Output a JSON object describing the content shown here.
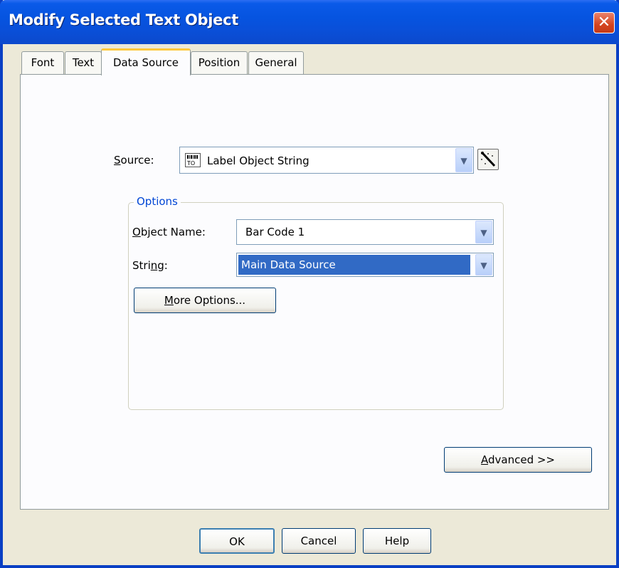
{
  "window": {
    "title": "Modify Selected Text Object",
    "close_glyph": "✕"
  },
  "tabs": [
    {
      "label": "Font",
      "active": false
    },
    {
      "label": "Text",
      "active": false
    },
    {
      "label": "Data Source",
      "active": true
    },
    {
      "label": "Position",
      "active": false
    },
    {
      "label": "General",
      "active": false
    }
  ],
  "source": {
    "label_mnemonic": "S",
    "label_rest": "ource:",
    "value": "Label Object String",
    "icon": "label-object-icon",
    "wizard_icon": "magic-wand-icon"
  },
  "options": {
    "legend": "Options",
    "object_name": {
      "label_mnemonic": "O",
      "label_rest": "bject Name:",
      "value": "Bar Code 1"
    },
    "string": {
      "label_pre": "Stri",
      "label_mnemonic": "n",
      "label_post": "g:",
      "value": "Main Data Source"
    },
    "more_options": {
      "mnemonic": "M",
      "rest": "ore Options..."
    }
  },
  "advanced": {
    "mnemonic": "A",
    "rest": "dvanced >>"
  },
  "footer": {
    "ok": "OK",
    "cancel": "Cancel",
    "help": "Help"
  },
  "colors": {
    "titlebar": "#0a5ae8",
    "selection": "#316ac5",
    "tab_highlight": "#ffc83c",
    "group_legend": "#0046d5"
  }
}
